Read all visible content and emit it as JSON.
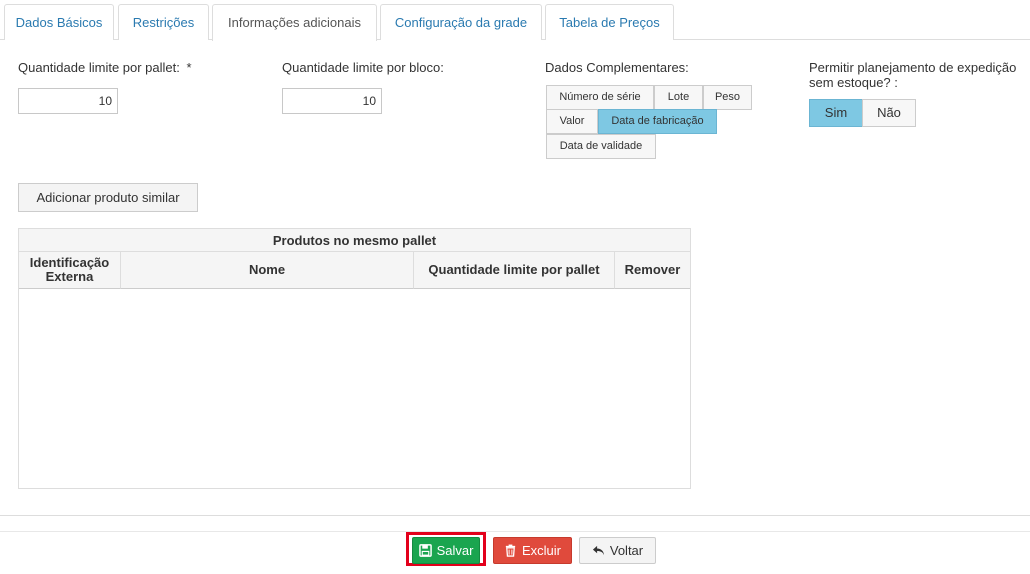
{
  "tabs": [
    {
      "label": "Dados Básicos"
    },
    {
      "label": "Restrições"
    },
    {
      "label": "Informações adicionais"
    },
    {
      "label": "Configuração da grade"
    },
    {
      "label": "Tabela de Preços"
    }
  ],
  "active_tab": "Informações adicionais",
  "fields": {
    "pallet_limit_label": "Quantidade limite por pallet:",
    "required_mark": "*",
    "pallet_limit_value": "10",
    "block_limit_label": "Quantidade limite por bloco:",
    "block_limit_value": "10"
  },
  "complementary": {
    "label": "Dados Complementares:",
    "options": {
      "serial": "Número de série",
      "lot": "Lote",
      "weight": "Peso",
      "value": "Valor",
      "manufacture_date": "Data de fabricação",
      "expiry_date": "Data de validade"
    },
    "selected": [
      "Data de fabricação"
    ]
  },
  "shipping": {
    "label_line1": "Permitir planejamento de expedição",
    "label_line2": "sem estoque? :",
    "yes": "Sim",
    "no": "Não",
    "selected": "Sim"
  },
  "similar_button": "Adicionar produto similar",
  "grid": {
    "caption": "Produtos no mesmo pallet",
    "col_ext_line1": "Identificação",
    "col_ext_line2": "Externa",
    "col_name": "Nome",
    "col_limit": "Quantidade limite por pallet",
    "col_remove": "Remover",
    "rows": []
  },
  "footer": {
    "save": "Salvar",
    "delete": "Excluir",
    "back": "Voltar"
  },
  "colors": {
    "accent_link": "#2a7ab0",
    "toggle_on": "#7ec8e3",
    "save": "#1aa54f",
    "delete": "#e04a3c",
    "highlight": "#e3001b"
  }
}
